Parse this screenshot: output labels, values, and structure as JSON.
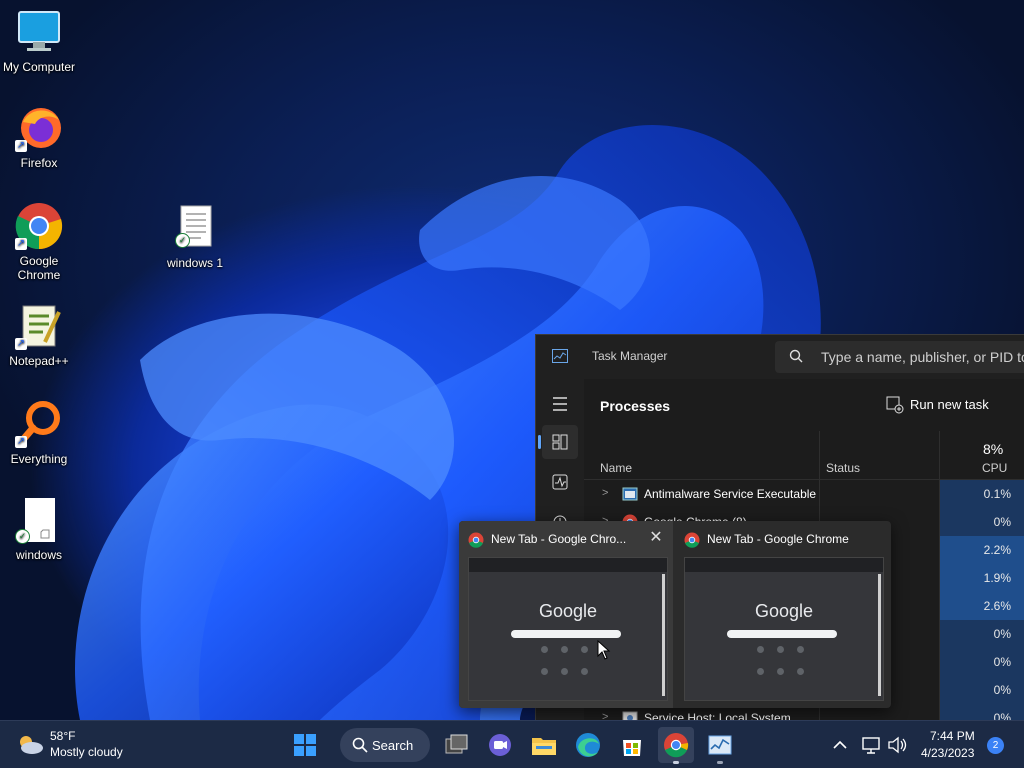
{
  "desktop": {
    "icons": [
      {
        "label": "My Computer"
      },
      {
        "label": "Firefox"
      },
      {
        "label": "Google Chrome"
      },
      {
        "label": "Notepad++"
      },
      {
        "label": "Everything"
      },
      {
        "label": "windows"
      },
      {
        "label": "windows 1"
      }
    ]
  },
  "task_manager": {
    "title": "Task Manager",
    "search_placeholder": "Type a name, publisher, or PID to",
    "section_title": "Processes",
    "run_new_task": "Run new task",
    "columns": {
      "name": "Name",
      "status": "Status",
      "cpu_pct": "8%",
      "cpu": "CPU"
    },
    "rows": [
      {
        "name": "Antimalware Service Executable",
        "cpu": "0.1%"
      },
      {
        "name": "Google Chrome (8)",
        "cpu": "0%"
      },
      {
        "name": "",
        "cpu": "2.2%"
      },
      {
        "name": "",
        "cpu": "1.9%"
      },
      {
        "name": "",
        "cpu": "2.6%"
      },
      {
        "name": "",
        "cpu": "0%"
      },
      {
        "name": "",
        "cpu": "0%"
      },
      {
        "name": "",
        "cpu": "0%"
      },
      {
        "name": "Service Host: Local System",
        "cpu": "0%"
      }
    ]
  },
  "chrome_thumbnails": [
    {
      "title": "New Tab - Google Chro...",
      "page_logo": "Google"
    },
    {
      "title": "New Tab - Google Chrome",
      "page_logo": "Google"
    }
  ],
  "taskbar": {
    "weather": {
      "temp": "58°F",
      "desc": "Mostly cloudy"
    },
    "search_label": "Search",
    "clock": {
      "time": "7:44 PM",
      "date": "4/23/2023"
    },
    "notifications": "2"
  },
  "colors": {
    "accent": "#3b82f6",
    "taskbar": "#1c2a45",
    "cpu_highlight": "#1f4e8c",
    "cpu_low": "#1b3760"
  }
}
